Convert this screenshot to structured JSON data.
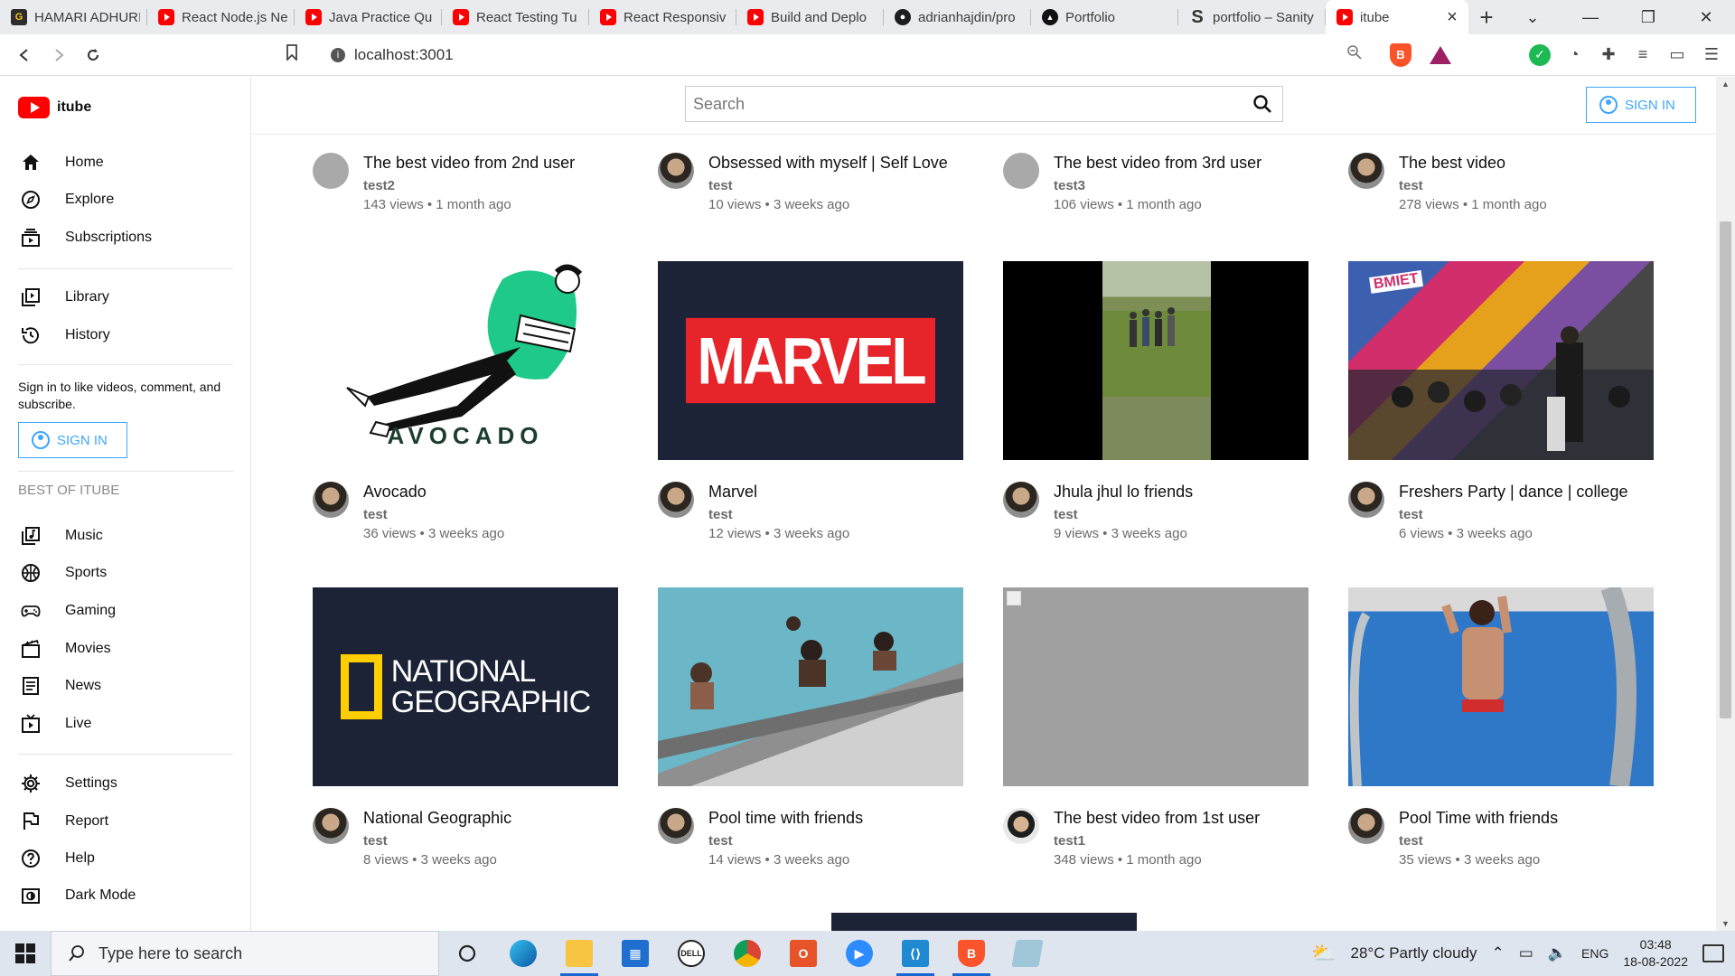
{
  "browser": {
    "tabs": [
      {
        "title": "HAMARI ADHURI",
        "favicon": "g-icon",
        "active": false
      },
      {
        "title": "React Node.js Ne",
        "favicon": "youtube-icon",
        "active": false
      },
      {
        "title": "Java Practice Qu",
        "favicon": "youtube-icon",
        "active": false
      },
      {
        "title": "React Testing Tu",
        "favicon": "youtube-icon",
        "active": false
      },
      {
        "title": "React Responsiv",
        "favicon": "youtube-icon",
        "active": false
      },
      {
        "title": "Build and Deplo",
        "favicon": "youtube-icon",
        "active": false
      },
      {
        "title": "adrianhajdin/pro",
        "favicon": "github-icon",
        "active": false
      },
      {
        "title": "Portfolio",
        "favicon": "triangle-icon",
        "active": false
      },
      {
        "title": "portfolio – Sanity",
        "favicon": "sanity-icon",
        "active": false
      },
      {
        "title": "itube",
        "favicon": "youtube-icon",
        "active": true
      }
    ],
    "url": "localhost:3001"
  },
  "app": {
    "logo_text": "itube",
    "search_placeholder": "Search",
    "header_signin_label": "SIGN IN",
    "sidebar": {
      "group1": [
        {
          "label": "Home",
          "icon": "home-icon"
        },
        {
          "label": "Explore",
          "icon": "compass-icon"
        },
        {
          "label": "Subscriptions",
          "icon": "subscriptions-icon"
        }
      ],
      "group2": [
        {
          "label": "Library",
          "icon": "library-icon"
        },
        {
          "label": "History",
          "icon": "history-icon"
        }
      ],
      "signin_prompt": "Sign in to like videos, comment, and subscribe.",
      "signin_label": "SIGN IN",
      "section_title": "BEST OF ITUBE",
      "group3": [
        {
          "label": "Music",
          "icon": "music-icon"
        },
        {
          "label": "Sports",
          "icon": "sports-icon"
        },
        {
          "label": "Gaming",
          "icon": "gaming-icon"
        },
        {
          "label": "Movies",
          "icon": "movies-icon"
        },
        {
          "label": "News",
          "icon": "news-icon"
        },
        {
          "label": "Live",
          "icon": "live-icon"
        }
      ],
      "group4": [
        {
          "label": "Settings",
          "icon": "settings-icon"
        },
        {
          "label": "Report",
          "icon": "flag-icon"
        },
        {
          "label": "Help",
          "icon": "help-icon"
        },
        {
          "label": "Dark Mode",
          "icon": "dark-mode-icon"
        }
      ]
    },
    "videos_top": [
      {
        "title": "The best video from 2nd user",
        "channel": "test2",
        "stats": "143 views • 1 month ago"
      },
      {
        "title": "Obsessed with myself | Self Love",
        "channel": "test",
        "stats": "10 views • 3 weeks ago"
      },
      {
        "title": "The best video from 3rd user",
        "channel": "test3",
        "stats": "106 views • 1 month ago"
      },
      {
        "title": "The best video",
        "channel": "test",
        "stats": "278 views • 1 month ago"
      }
    ],
    "videos_row2": [
      {
        "title": "Avocado",
        "channel": "test",
        "stats": "36 views • 3 weeks ago",
        "thumb_text": "AVOCADO"
      },
      {
        "title": "Marvel",
        "channel": "test",
        "stats": "12 views • 3 weeks ago",
        "thumb_text": "MARVEL"
      },
      {
        "title": "Jhula jhul lo friends",
        "channel": "test",
        "stats": "9 views • 3 weeks ago"
      },
      {
        "title": "Freshers Party | dance | college",
        "channel": "test",
        "stats": "6 views • 3 weeks ago",
        "thumb_text": "BMIET"
      }
    ],
    "videos_row3": [
      {
        "title": "National Geographic",
        "channel": "test",
        "stats": "8 views • 3 weeks ago",
        "thumb_text_1": "NATIONAL",
        "thumb_text_2": "GEOGRAPHIC"
      },
      {
        "title": "Pool time with friends",
        "channel": "test",
        "stats": "14 views • 3 weeks ago"
      },
      {
        "title": "The best video from 1st user",
        "channel": "test1",
        "stats": "348 views • 1 month ago"
      },
      {
        "title": "Pool Time with friends",
        "channel": "test",
        "stats": "35 views • 3 weeks ago"
      }
    ]
  },
  "taskbar": {
    "search_placeholder": "Type here to search",
    "weather": "28°C  Partly cloudy",
    "language": "ENG",
    "time": "03:48",
    "date": "18-08-2022"
  },
  "colors": {
    "accent_blue": "#3ea6ff",
    "brand_red": "#ff0000",
    "marvel_red": "#e62429",
    "natgeo_yellow": "#ffce00"
  }
}
